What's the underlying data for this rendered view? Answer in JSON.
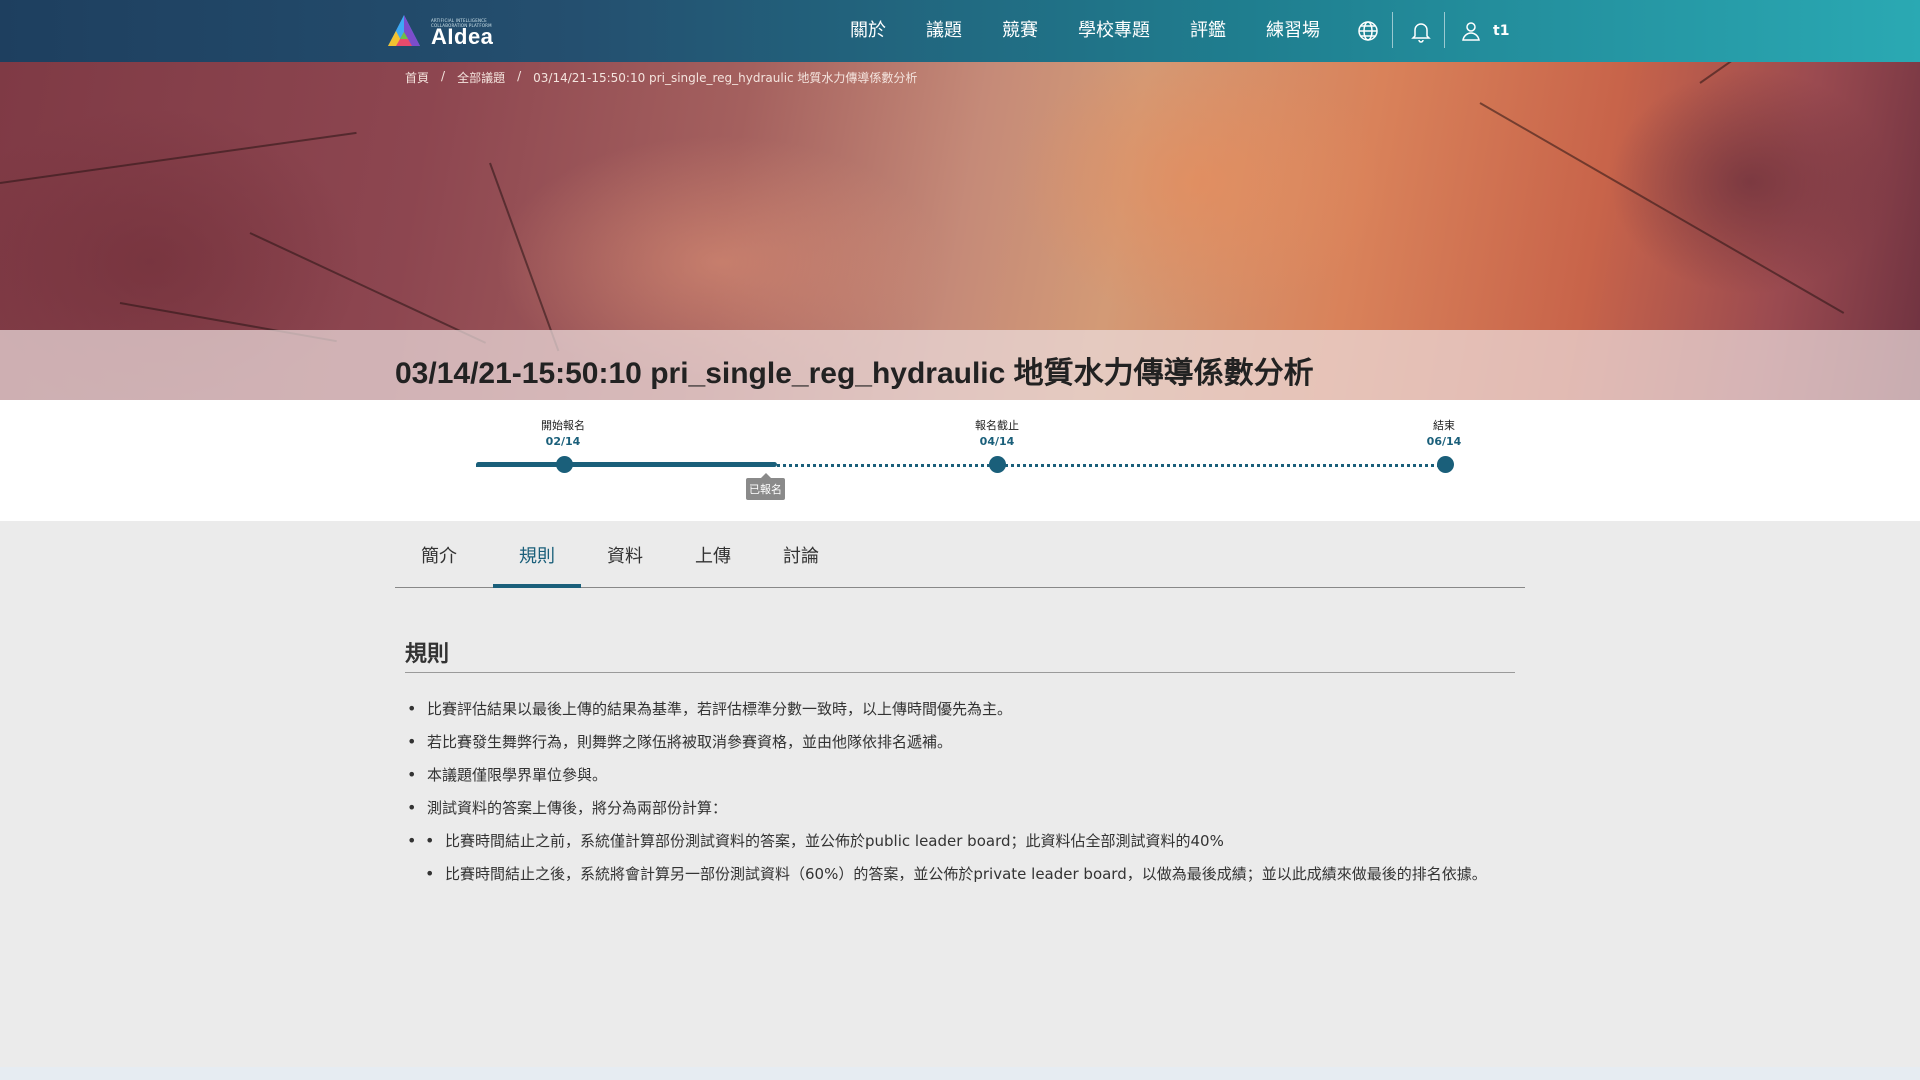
{
  "header": {
    "logo_text": "AIdea",
    "logo_tagline": "ARTIFICIAL INTELLIGENCE\nCOLLABORATION PLATFORM",
    "nav": [
      "關於",
      "議題",
      "競賽",
      "學校專題",
      "評鑑",
      "練習場"
    ],
    "user_name": "t1"
  },
  "breadcrumb": [
    "首頁",
    "/",
    "全部議題",
    "/",
    "03/14/21-15:50:10 pri_single_reg_hydraulic 地質水力傳導係數分析"
  ],
  "title": {
    "bold": "03/14/21-15:50:10 pri_single_reg_hydraulic",
    "rest": "地質水力傳導係數分析"
  },
  "timeline": {
    "milestones": [
      {
        "label": "開始報名",
        "date": "02/14"
      },
      {
        "label": "報名截止",
        "date": "04/14"
      },
      {
        "label": "結束",
        "date": "06/14"
      }
    ],
    "badge": "已報名",
    "progress_fraction": 0.31
  },
  "tabs": [
    "簡介",
    "規則",
    "資料",
    "上傳",
    "討論"
  ],
  "active_tab": "規則",
  "section_title": "規則",
  "rules": [
    "比賽評估結果以最後上傳的結果為基準，若評估標準分數一致時，以上傳時間優先為主。",
    "若比賽發生舞弊行為，則舞弊之隊伍將被取消參賽資格，並由他隊依排名遞補。",
    "本議題僅限學界單位參與。",
    "測試資料的答案上傳後，將分為兩部份計算："
  ],
  "sub_rules": [
    "比賽時間結止之前，系統僅計算部份測試資料的答案，並公佈於public leader board；此資料佔全部測試資料的40%",
    "比賽時間結止之後，系統將會計算另一部份測試資料（60%）的答案，並公佈於private leader board，以做為最後成績；並以此成績來做最後的排名依據。"
  ],
  "colors": {
    "accent": "#1a5f7a",
    "header_from": "#1e3f5f",
    "header_to": "#2aa9b3"
  }
}
